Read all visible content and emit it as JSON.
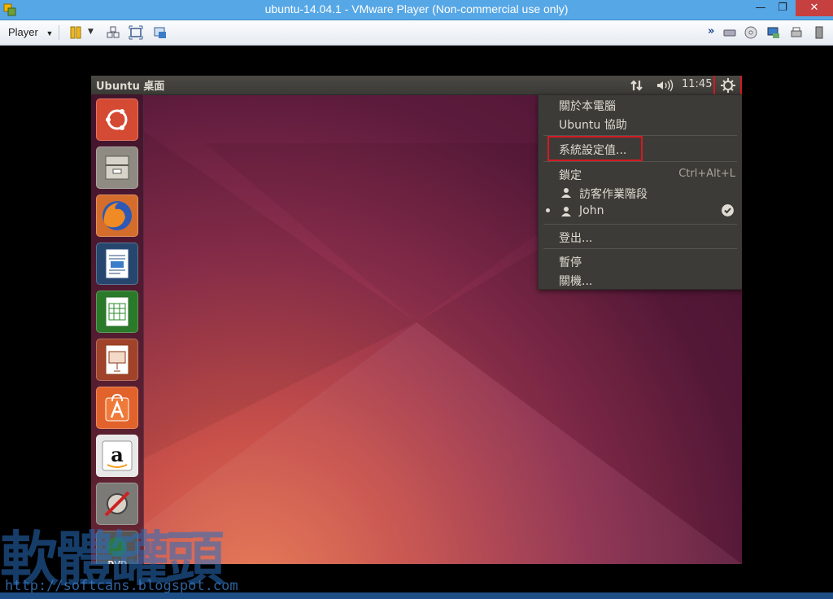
{
  "window": {
    "title": "ubuntu-14.04.1 - VMware Player (Non-commercial use only)",
    "min": "—",
    "max": "❐",
    "close": "✕"
  },
  "toolbar": {
    "player_label": "Player"
  },
  "vm": {
    "topbar_title": "Ubuntu 桌面",
    "clock": "11:45"
  },
  "menu": {
    "items": [
      {
        "label": "關於本電腦"
      },
      {
        "label": "Ubuntu 協助"
      },
      {
        "label": "系統設定值..."
      },
      {
        "label": "鎖定",
        "shortcut": "Ctrl+Alt+L"
      },
      {
        "label": "訪客作業階段"
      },
      {
        "label": "John"
      },
      {
        "label": "登出..."
      },
      {
        "label": "暫停"
      },
      {
        "label": "關機..."
      }
    ]
  },
  "launcher": {
    "apps": [
      "dash-home-icon",
      "files-icon",
      "firefox-icon",
      "writer-icon",
      "calc-icon",
      "impress-icon",
      "software-center-icon",
      "amazon-icon",
      "system-settings-icon",
      "dvd-icon"
    ]
  },
  "watermark": {
    "text": "軟體罐頭",
    "url": "http://softcans.blogspot.com"
  },
  "colors": {
    "accent_red": "#d31a22",
    "menu_bg": "#3c3b37",
    "titlebar": "#56a7e6"
  }
}
